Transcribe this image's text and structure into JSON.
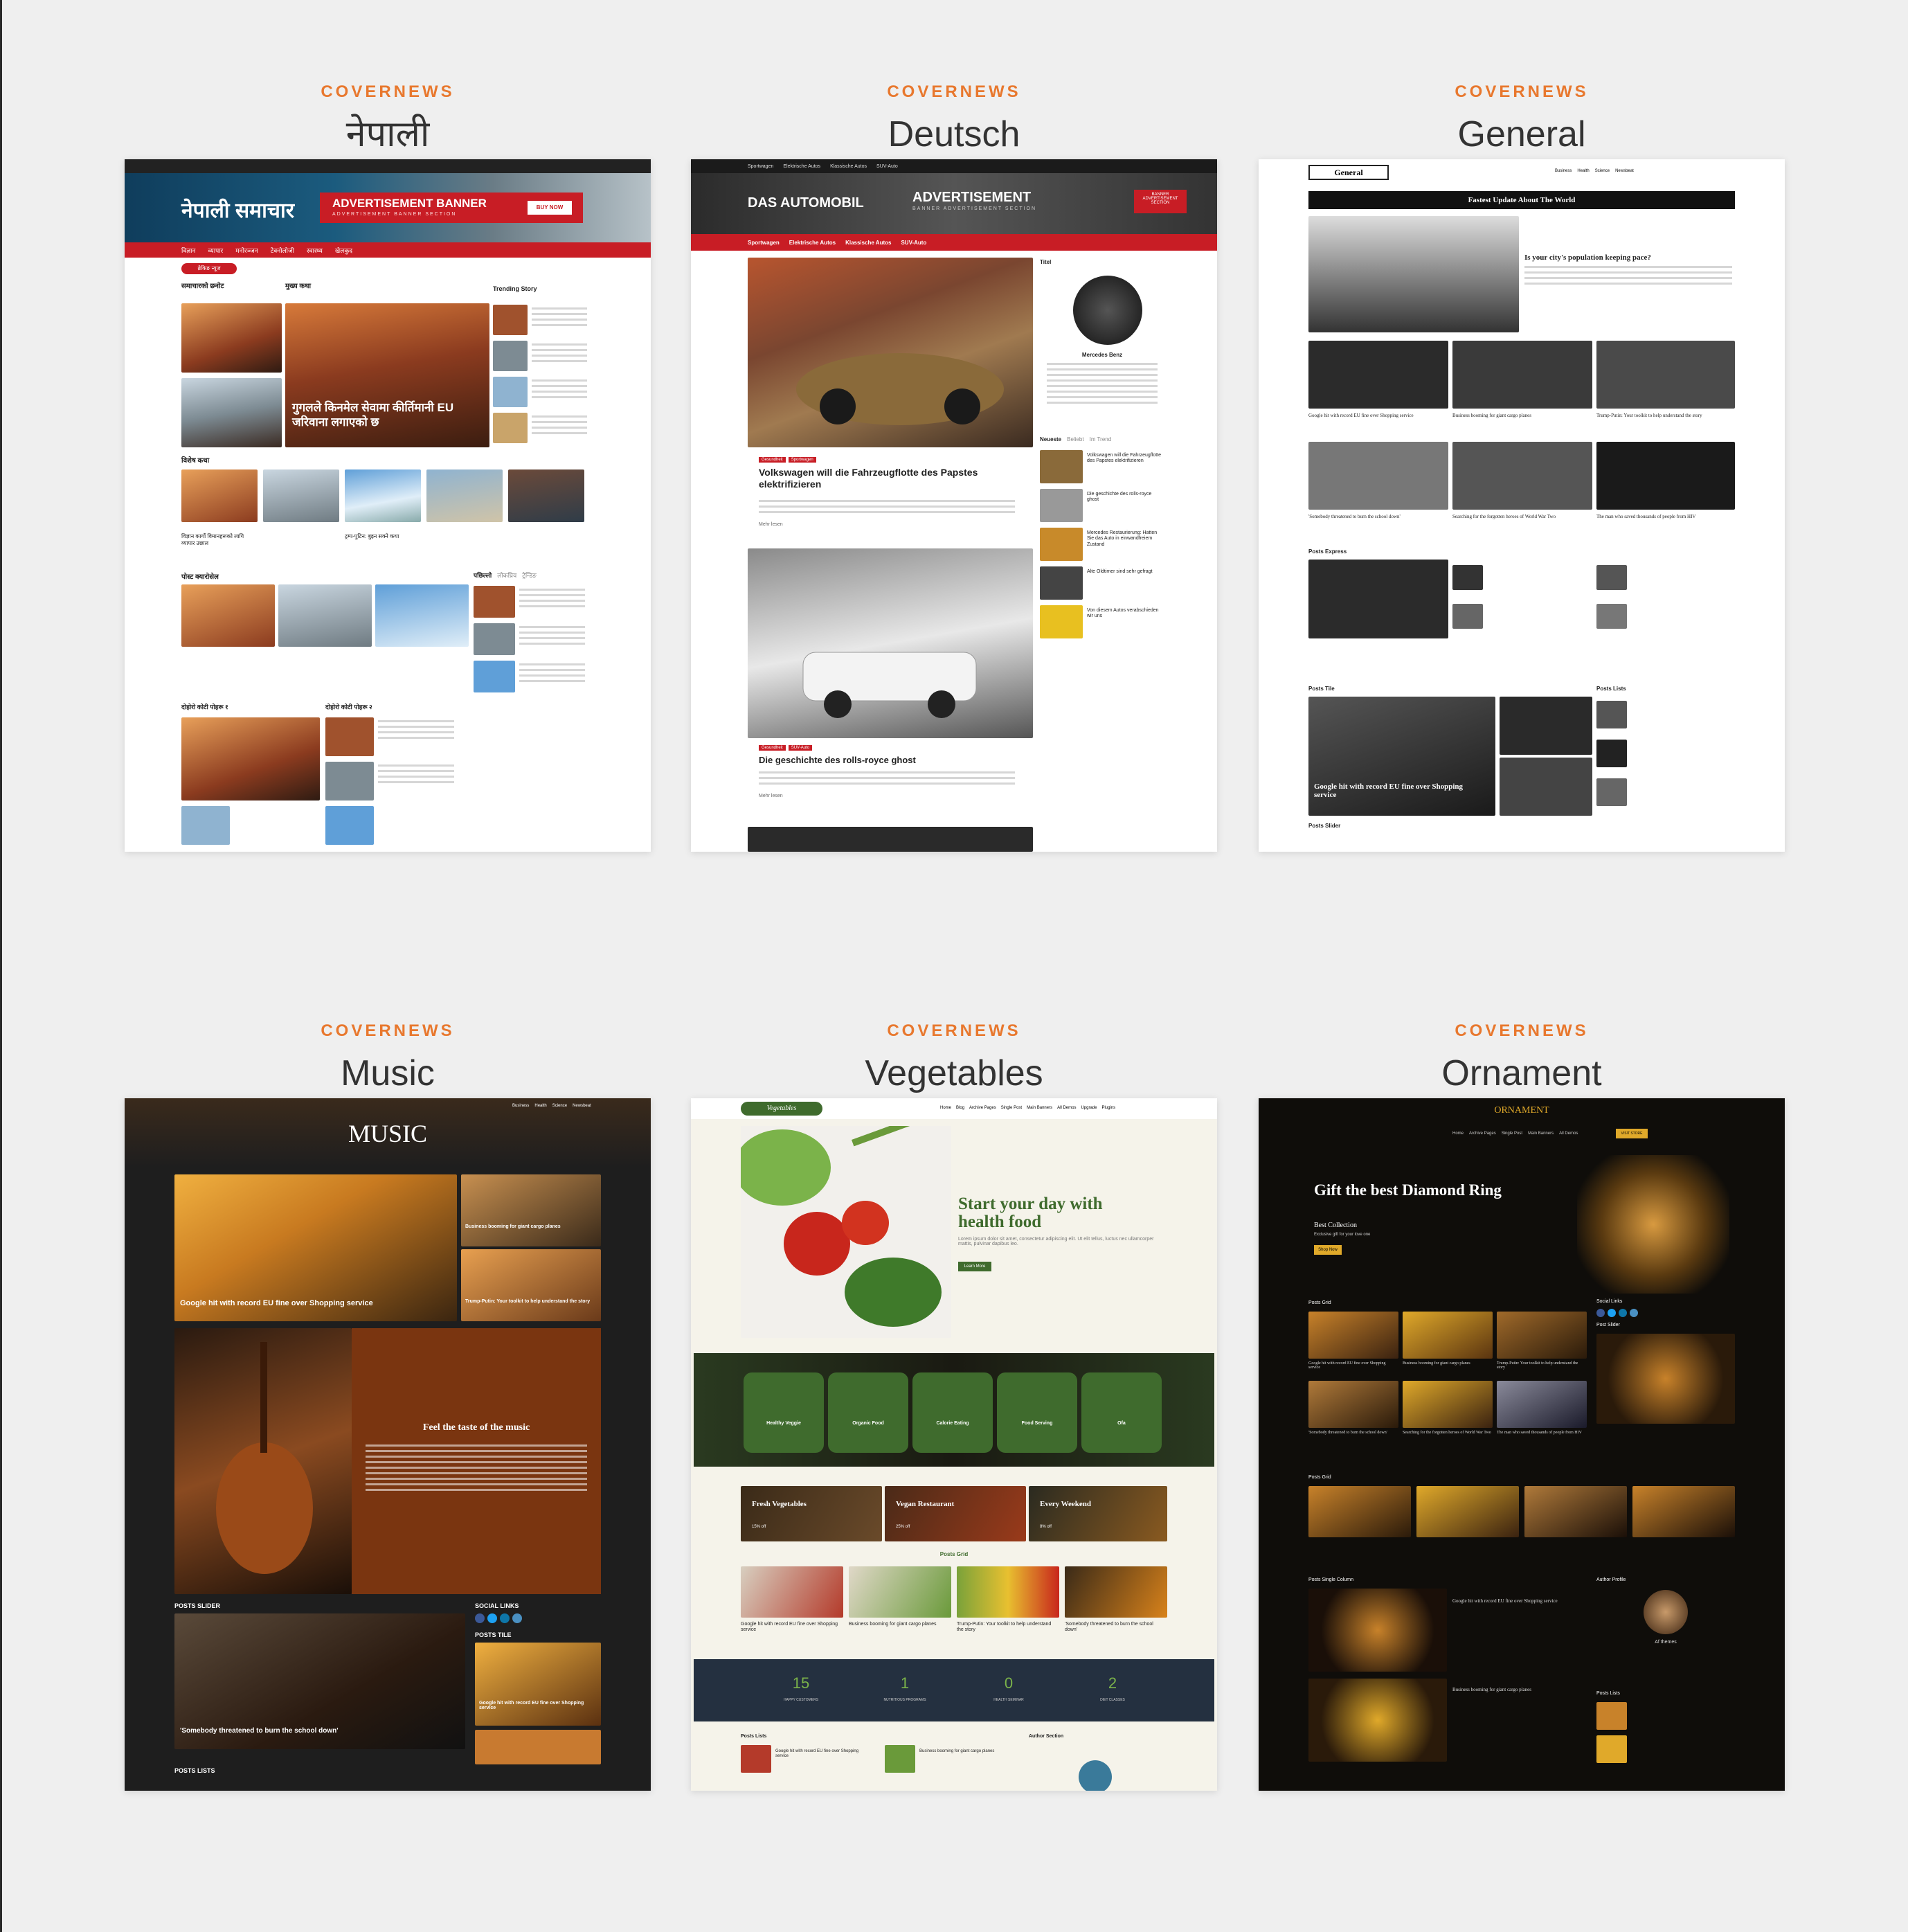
{
  "brand": "COVERNEWS",
  "colors": {
    "brand": "#e8782e",
    "title": "#333333",
    "background": "#efefef",
    "red": "#c81d25",
    "green": "#3f6b2d",
    "gold": "#e0a92a"
  },
  "demos": [
    {
      "title": "नेपाली",
      "site": {
        "logo": "नेपाली समाचार",
        "ad_title": "ADVERTISEMENT BANNER",
        "ad_sub": "ADVERTISEMENT BANNER SECTION",
        "ad_button": "BUY NOW",
        "nav": [
          "विज्ञान",
          "व्यापार",
          "मनोरञ्जन",
          "टेक्नोलोजी",
          "स्वास्थ्य",
          "खेलकुद"
        ],
        "breaking": "ब्रेकिङ न्यूज",
        "section1": "समाचारको छनोट",
        "main_heading": "मुख्य कथा",
        "trending": "Trending Story",
        "hero_headline": "गुगलले किनमेल सेवामा कीर्तिमानी EU जरिवाना लगाएको छ",
        "section2": "विशेष कथा",
        "section3": "पोस्ट क्यारोसेल",
        "tabs": [
          "पछिल्लो",
          "लोकप्रिय",
          "ट्रेन्डिङ"
        ],
        "section4": "दोहोरो कोटी पोहरू १",
        "section5": "दोहोरो कोटी पोहरू २",
        "story1": "विज्ञान कार्गो विमानहरूको लागि व्यापार उछाल",
        "story2": "ट्रम्प-पुटिन: बुझ्न सक्ने कथा"
      }
    },
    {
      "title": "Deutsch",
      "site": {
        "top_nav": [
          "Sportwagen",
          "Elektrische Autos",
          "Klassische Autos",
          "SUV-Auto"
        ],
        "logo": "DAS AUTOMOBIL",
        "ad_title": "ADVERTISEMENT",
        "ad_sub": "BANNER ADVERTISEMENT SECTION",
        "ad_badge": "BANNER ADVERTISEMENT SECTION",
        "nav": [
          "Sportwagen",
          "Elektrische Autos",
          "Klassische Autos",
          "SUV-Auto"
        ],
        "post1_title": "Volkswagen will die Fahrzeugflotte des Papstes elektrifizieren",
        "post1_tags": [
          "Gesundheit",
          "Sportwagen"
        ],
        "post2_title": "Die geschichte des rolls-royce ghost",
        "post2_tags": [
          "Gesundheit",
          "SUV-Auto"
        ],
        "read_more": "Mehr lesen",
        "sidebar_title": "Titel",
        "profile_name": "Mercedes Benz",
        "tabs": [
          "Neueste",
          "Beliebt",
          "Im Trend"
        ],
        "side_posts": [
          "Volkswagen will die Fahrzeugflotte des Papstes elektrifizieren",
          "Die geschichte des rolls-royce ghost",
          "Mercedes Restaurierung: Hatten Sie das Auto in einwandfreiem Zustand",
          "Alte Oldtimer sind sehr gefragt",
          "Von diesem Autos verabschieden wir uns"
        ]
      }
    },
    {
      "title": "General",
      "site": {
        "logo": "General",
        "nav": [
          "Business",
          "Health",
          "Science",
          "Newsbeat"
        ],
        "banner": "Fastest Update About The World",
        "hero_title": "Is your city's population keeping pace?",
        "grid_titles": [
          "Google hit with record EU fine over Shopping service",
          "Business booming for giant cargo planes",
          "Trump-Putin: Your toolkit to help understand the story",
          "'Somebody threatened to burn the school down'",
          "Searching for the forgotten heroes of World War Two",
          "The man who saved thousands of people from HIV"
        ],
        "posts_express": "Posts Express",
        "posts_tile": "Posts Tile",
        "posts_lists": "Posts Lists",
        "posts_slider": "Posts Slider",
        "tile_title": "Google hit with record EU fine over Shopping service"
      }
    },
    {
      "title": "Music",
      "site": {
        "logo": "MUSIC",
        "nav": [
          "Business",
          "Health",
          "Science",
          "Newsbeat"
        ],
        "hero_title": "Google hit with record EU fine over Shopping service",
        "side1": "Business booming for giant cargo planes",
        "side2": "Trump-Putin: Your toolkit to help understand the story",
        "feature_title": "Feel the taste of the music",
        "posts_slider": "POSTS SLIDER",
        "slider_title": "'Somebody threatened to burn the school down'",
        "social_links": "SOCIAL LINKS",
        "posts_tile": "POSTS TILE",
        "tile_title": "Google hit with record EU fine over Shopping service",
        "posts_lists": "POSTS LISTS"
      }
    },
    {
      "title": "Vegetables",
      "site": {
        "logo": "Vegetables",
        "nav": [
          "Home",
          "Blog",
          "Archive Pages",
          "Single Post",
          "Main Banners",
          "All Demos",
          "Upgrade",
          "Plugins"
        ],
        "hero_title": "Start your day with health food",
        "hero_text": "Lorem ipsum dolor sit amet, consectetur adipiscing elit. Ut elit tellus, luctus nec ullamcorper mattis, pulvinar dapibus leo.",
        "hero_button": "Learn More",
        "services": [
          "Healthy Veggie",
          "Organic Food",
          "Calorie Eating",
          "Food Serving",
          "Ofa"
        ],
        "promos": [
          {
            "title": "Fresh Vegetables",
            "sub": "15% off"
          },
          {
            "title": "Vegan Restaurant",
            "sub": "25% off"
          },
          {
            "title": "Every Weekend",
            "sub": "8% off"
          }
        ],
        "posts_grid": "Posts Grid",
        "grid_titles": [
          "Google hit with record EU fine over Shopping service",
          "Business booming for giant cargo planes",
          "Trump-Putin: Your toolkit to help understand the story",
          "'Somebody threatened to burn the school down'"
        ],
        "stats": [
          {
            "value": "15",
            "label": "HAPPY CUSTOMERS"
          },
          {
            "value": "1",
            "label": "NUTRITIOUS PROGRAMS"
          },
          {
            "value": "0",
            "label": "HEALTH SEMINAR"
          },
          {
            "value": "2",
            "label": "DIET CLASSES"
          }
        ],
        "posts_lists": "Posts Lists",
        "author_section": "Author Section",
        "list_titles": [
          "Google hit with record EU fine over Shopping service",
          "Business booming for giant cargo planes"
        ]
      }
    },
    {
      "title": "Ornament",
      "site": {
        "logo": "ORNAMENT",
        "nav": [
          "Home",
          "Archive Pages",
          "Single Post",
          "Main Banners",
          "All Demos"
        ],
        "nav_button": "VISIT STORE",
        "hero_title": "Gift the best Diamond Ring",
        "hero_sub": "Best Collection",
        "hero_text": "Exclusive gift for your love one",
        "hero_button": "Shop Now",
        "posts_grid": "Posts Grid",
        "social_links": "Social Links",
        "post_slider": "Post Slider",
        "grid_titles": [
          "Google hit with record EU fine over Shopping service",
          "Business booming for giant cargo planes",
          "Trump-Putin: Your toolkit to help understand the story",
          "'Somebody threatened to burn the school down'",
          "Searching for the forgotten heroes of World War Two",
          "The man who saved thousands of people from HIV"
        ],
        "posts_single_column": "Posts Single Column",
        "author_profile": "Author Profile",
        "author_name": "Af themes",
        "posts_lists": "Posts Lists"
      }
    }
  ]
}
